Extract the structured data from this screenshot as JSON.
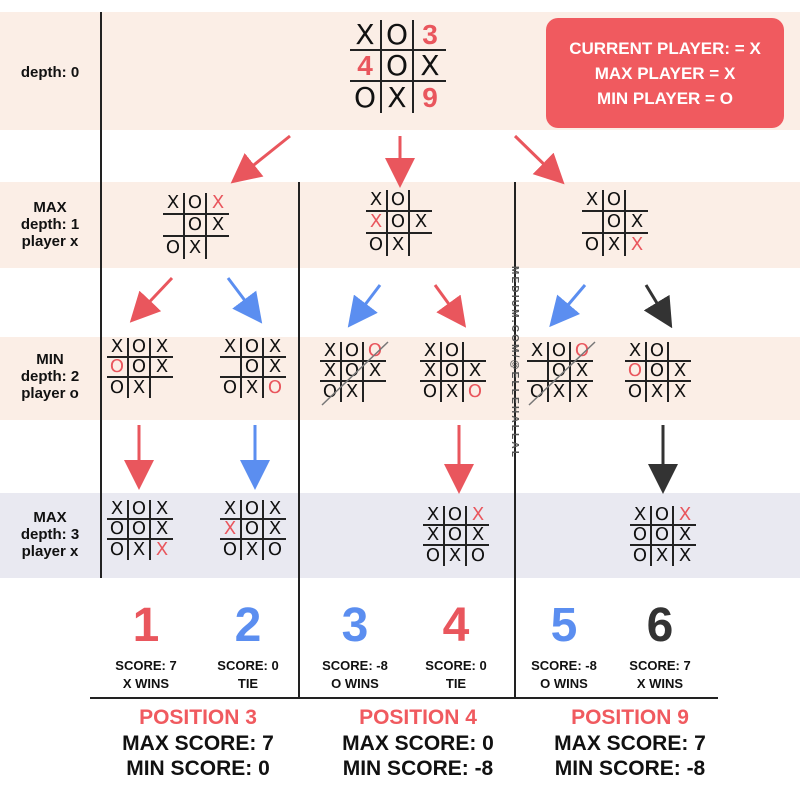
{
  "colors": {
    "red": "#e9565d",
    "blue": "#5b8ef0",
    "dark": "#333333",
    "peach": "#fbeee6",
    "gray": "#e9e9f1",
    "accent_box": "#f05a5f"
  },
  "labels": {
    "depth0": "depth: 0",
    "depth1": [
      "MAX",
      "depth: 1",
      "player x"
    ],
    "depth2": [
      "MIN",
      "depth: 2",
      "player o"
    ],
    "depth3": [
      "MAX",
      "depth: 3",
      "player x"
    ]
  },
  "info_box": {
    "line1": "CURRENT PLAYER: = X",
    "line2": "MAX PLAYER = X",
    "line3": "MIN PLAYER = O"
  },
  "root_board": [
    "X",
    "O",
    "3",
    "4",
    "O",
    "X",
    "O",
    "X",
    "9"
  ],
  "depth1_boards": [
    [
      "X",
      "O",
      "X*",
      "",
      "O",
      "X",
      "O",
      "X",
      ""
    ],
    [
      "X",
      "O",
      "",
      "X*",
      "O",
      "X",
      "O",
      "X",
      ""
    ],
    [
      "X",
      "O",
      "",
      "",
      "O",
      "X",
      "O",
      "X",
      "X*"
    ]
  ],
  "depth2_boards": [
    [
      "X",
      "O",
      "X",
      "O*",
      "O",
      "X",
      "O",
      "X",
      ""
    ],
    [
      "X",
      "O",
      "X",
      "",
      "O",
      "X",
      "O",
      "X",
      "O*"
    ],
    [
      "X",
      "O",
      "O*",
      "X",
      "O",
      "X",
      "O",
      "X",
      ""
    ],
    [
      "X",
      "O",
      "",
      "X",
      "O",
      "X",
      "O",
      "X",
      "O*"
    ],
    [
      "X",
      "O",
      "O*",
      "",
      "O",
      "X",
      "O",
      "X",
      "X"
    ],
    [
      "X",
      "O",
      "",
      "O*",
      "O",
      "X",
      "O",
      "X",
      "X"
    ]
  ],
  "depth3_boards": [
    [
      "X",
      "O",
      "X",
      "O",
      "O",
      "X",
      "O",
      "X",
      "X*"
    ],
    [
      "X",
      "O",
      "X",
      "X*",
      "O",
      "X",
      "O",
      "X",
      "O"
    ],
    [
      "X",
      "O",
      "X*",
      "X",
      "O",
      "X",
      "O",
      "X",
      "O"
    ],
    [
      "X",
      "O",
      "X*",
      "O",
      "O",
      "X",
      "O",
      "X",
      "X"
    ]
  ],
  "watermark": "MEDIUM.COM/@ELLEHALLAL",
  "outcomes": [
    {
      "number": "1",
      "score": "SCORE: 7",
      "result": "X WINS",
      "color": "#e9565d"
    },
    {
      "number": "2",
      "score": "SCORE: 0",
      "result": "TIE",
      "color": "#5b8ef0"
    },
    {
      "number": "3",
      "score": "SCORE: -8",
      "result": "O WINS",
      "color": "#5b8ef0"
    },
    {
      "number": "4",
      "score": "SCORE: 0",
      "result": "TIE",
      "color": "#e9565d"
    },
    {
      "number": "5",
      "score": "SCORE: -8",
      "result": "O WINS",
      "color": "#5b8ef0"
    },
    {
      "number": "6",
      "score": "SCORE: 7",
      "result": "X WINS",
      "color": "#333333"
    }
  ],
  "positions": [
    {
      "title": "POSITION 3",
      "max": "MAX SCORE: 7",
      "min": "MIN SCORE: 0"
    },
    {
      "title": "POSITION 4",
      "max": "MAX SCORE: 0",
      "min": "MIN SCORE: -8"
    },
    {
      "title": "POSITION 9",
      "max": "MAX SCORE: 7",
      "min": "MIN SCORE: -8"
    }
  ]
}
